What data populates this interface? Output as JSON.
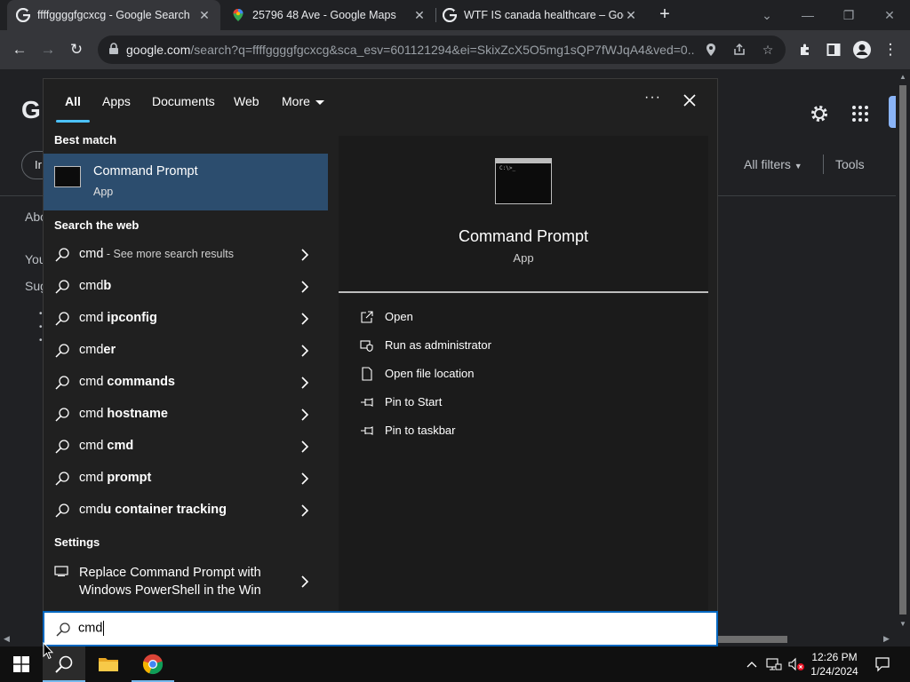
{
  "browser": {
    "tabs": [
      {
        "title": "ffffggggfgcxcg - Google Search",
        "active": true
      },
      {
        "title": "25796 48 Ave - Google Maps",
        "active": false
      },
      {
        "title": "WTF IS canada healthcare – Goo",
        "active": false
      }
    ],
    "url_host": "google.com",
    "url_rest": "/search?q=ffffggggfgcxcg&sca_esv=601121294&ei=SkixZcX5O5mg1sQP7fWJqA4&ved=0..."
  },
  "page": {
    "logo_fragment": "G",
    "filter_fragment": "Ir",
    "all_filters": "All filters",
    "tools": "Tools",
    "fragments": [
      "Abo",
      "You",
      "Sug"
    ]
  },
  "search_flyout": {
    "tabs": [
      "All",
      "Apps",
      "Documents",
      "Web",
      "More"
    ],
    "more_dots": "···",
    "best_match_label": "Best match",
    "best_match": {
      "name": "Command Prompt",
      "type": "App"
    },
    "web_label": "Search the web",
    "web_results": [
      {
        "prefix": "cmd",
        "bold": "",
        "suffix": " - See more search results"
      },
      {
        "prefix": "cmd",
        "bold": "b",
        "suffix": ""
      },
      {
        "prefix": "cmd",
        "bold": " ipconfig",
        "suffix": ""
      },
      {
        "prefix": "cmd",
        "bold": "er",
        "suffix": ""
      },
      {
        "prefix": "cmd",
        "bold": " commands",
        "suffix": ""
      },
      {
        "prefix": "cmd",
        "bold": " hostname",
        "suffix": ""
      },
      {
        "prefix": "cmd",
        "bold": " cmd",
        "suffix": ""
      },
      {
        "prefix": "cmd",
        "bold": " prompt",
        "suffix": ""
      },
      {
        "prefix": "cmd",
        "bold": "u container tracking",
        "suffix": ""
      }
    ],
    "settings_label": "Settings",
    "settings_item": "Replace Command Prompt with Windows PowerShell in the Win",
    "preview": {
      "name": "Command Prompt",
      "type": "App",
      "actions": [
        "Open",
        "Run as administrator",
        "Open file location",
        "Pin to Start",
        "Pin to taskbar"
      ]
    },
    "query": "cmd"
  },
  "taskbar": {
    "time": "12:26 PM",
    "date": "1/24/2024"
  },
  "colors": {
    "selection": "#2c4d6e",
    "accent": "#4cc2ff",
    "flyout_bg": "#202020"
  }
}
